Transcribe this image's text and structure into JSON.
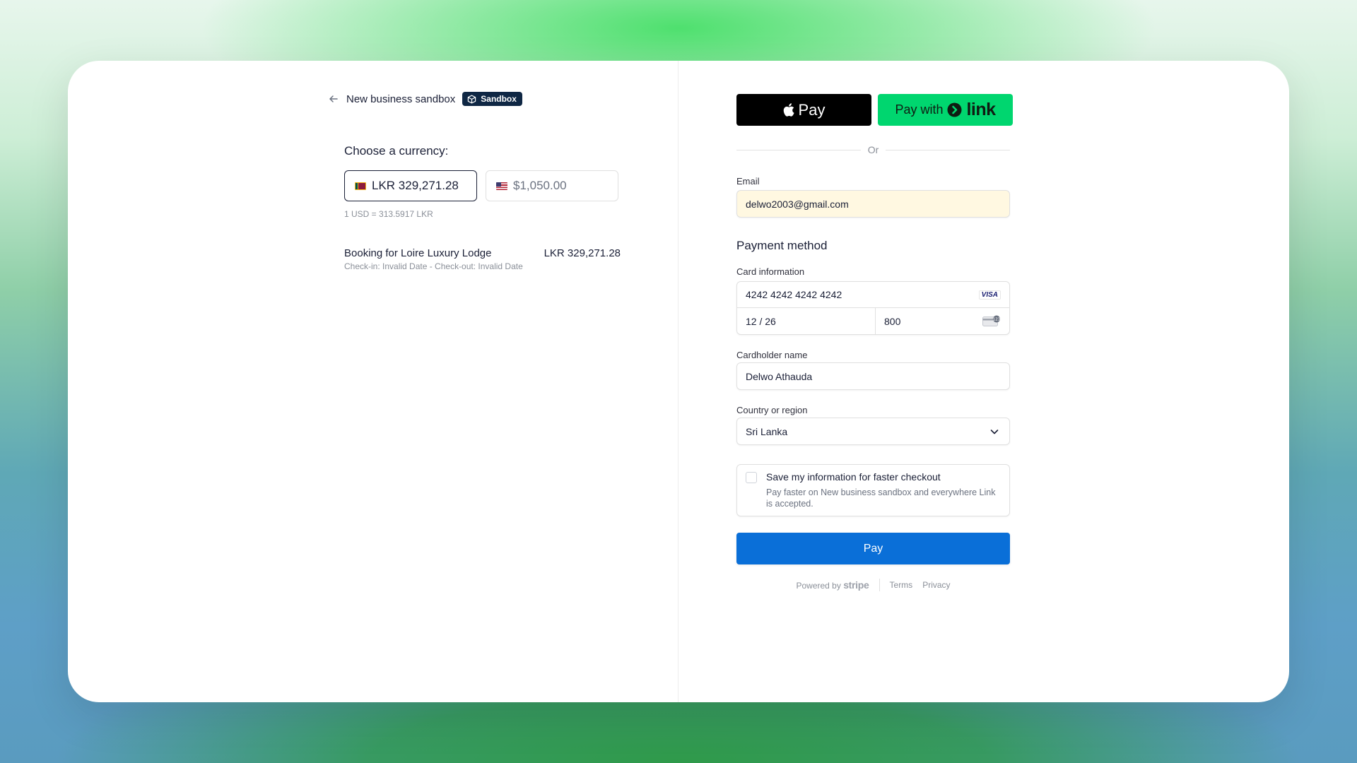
{
  "header": {
    "merchant_name": "New business sandbox",
    "badge_label": "Sandbox"
  },
  "currency": {
    "heading": "Choose a currency:",
    "options": [
      {
        "label": "LKR 329,271.28",
        "selected": true
      },
      {
        "label": "$1,050.00",
        "selected": false
      }
    ],
    "rate": "1 USD = 313.5917 LKR"
  },
  "line_item": {
    "name": "Booking for Loire Luxury Lodge",
    "detail": "Check-in: Invalid Date - Check-out: Invalid Date",
    "price": "LKR 329,271.28"
  },
  "wallets": {
    "apple_pay": "Pay",
    "link_prefix": "Pay with",
    "link_word": "link"
  },
  "separator_text": "Or",
  "email": {
    "label": "Email",
    "value": "delwo2003@gmail.com"
  },
  "payment_method": {
    "title": "Payment method",
    "card_label": "Card information",
    "card_number": "4242 4242 4242 4242",
    "card_brand": "VISA",
    "expiry": "12 / 26",
    "cvc": "800"
  },
  "cardholder": {
    "label": "Cardholder name",
    "value": "Delwo Athauda"
  },
  "country": {
    "label": "Country or region",
    "value": "Sri Lanka"
  },
  "save_info": {
    "title": "Save my information for faster checkout",
    "description": "Pay faster on New business sandbox and everywhere Link is accepted.",
    "checked": false
  },
  "pay_button": "Pay",
  "footer": {
    "powered_by": "Powered by",
    "brand": "stripe",
    "terms": "Terms",
    "privacy": "Privacy"
  },
  "colors": {
    "pay_button": "#0a6fd8",
    "link_green": "#00d66f",
    "sandbox_badge": "#0f2744",
    "email_autofill": "#fff8e1"
  }
}
